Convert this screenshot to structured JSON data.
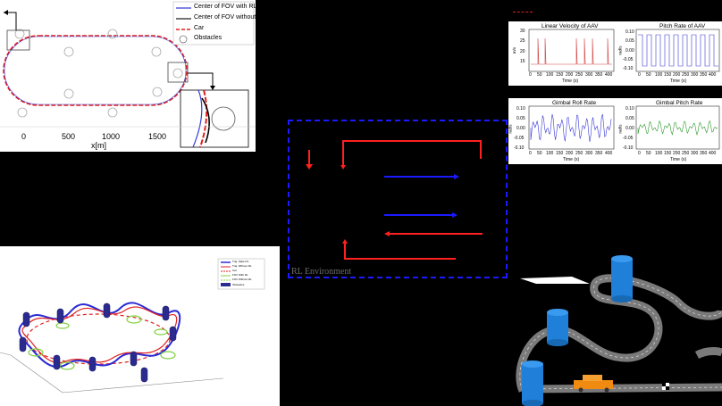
{
  "top_left_plot": {
    "legend": [
      {
        "label": "Center of FOV with RL",
        "color": "#3b3bd6"
      },
      {
        "label": "Center of FOV without RL",
        "color": "#222222"
      },
      {
        "label": "Car",
        "color": "#e02020"
      },
      {
        "label": "Obstacles",
        "color": "#777777"
      }
    ],
    "x_ticks": [
      "0",
      "500",
      "1000",
      "1500"
    ],
    "x_label": "x[m]"
  },
  "plots_3d": {
    "legend": [
      "Traj. State RL",
      "Traj. Without RL",
      "Car",
      "FOV With RL",
      "FOV Without RL",
      "Obstacles"
    ]
  },
  "small_charts": [
    {
      "title": "Linear Velocity of AAV",
      "ylabel": "m/s",
      "yticks": [
        "30",
        "25",
        "20",
        "15"
      ],
      "xticks": [
        "0",
        "50",
        "100",
        "150",
        "200",
        "250",
        "300",
        "350",
        "400"
      ],
      "xlabel": "Time (s)",
      "color": "#d04040"
    },
    {
      "title": "Pitch Rate of AAV",
      "ylabel": "rad/s",
      "yticks": [
        "0.10",
        "0.05",
        "0.00",
        "-0.05",
        "-0.10"
      ],
      "xticks": [
        "0",
        "50",
        "100",
        "150",
        "200",
        "250",
        "300",
        "350",
        "400"
      ],
      "xlabel": "Time (s)",
      "color": "#3a3ad6"
    },
    {
      "title": "Gimbal Roll Rate",
      "ylabel": "rad/s",
      "yticks": [
        "0.10",
        "0.05",
        "0.00",
        "-0.05",
        "-0.10"
      ],
      "xticks": [
        "0",
        "50",
        "100",
        "150",
        "200",
        "250",
        "300",
        "350",
        "400"
      ],
      "xlabel": "Time (s)",
      "color": "#3a3ad6"
    },
    {
      "title": "Gimbal Pitch Rate",
      "ylabel": "rad/s",
      "yticks": [
        "0.10",
        "0.05",
        "0.00",
        "-0.05",
        "-0.10"
      ],
      "xticks": [
        "0",
        "50",
        "100",
        "150",
        "200",
        "250",
        "300",
        "350",
        "400"
      ],
      "xlabel": "Time (s)",
      "color": "#2c9a2c"
    }
  ],
  "rl_box": {
    "label": "RL Environment",
    "border_color": "#1a1aff",
    "arrow_red": "#ff2020",
    "arrow_blue": "#1a1aff"
  },
  "scene": {
    "road_color": "#777777",
    "obstacle_color": "#1f7fd9",
    "car_color": "#f08a10"
  }
}
